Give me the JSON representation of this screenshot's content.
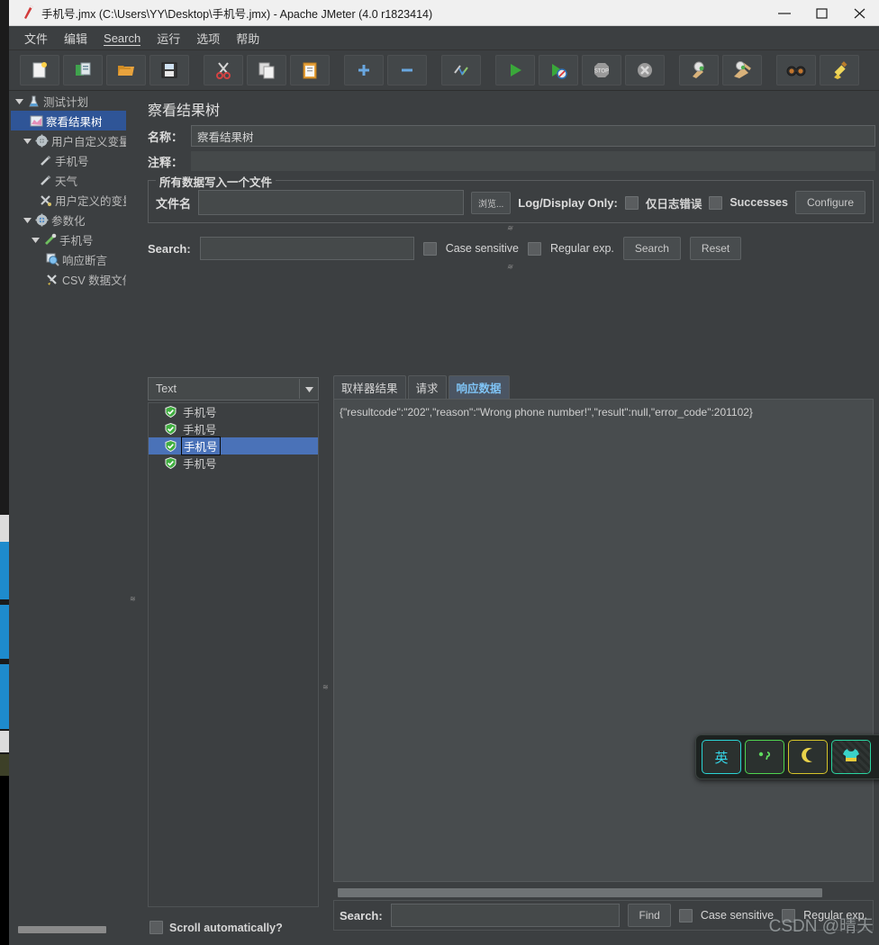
{
  "window": {
    "title": "手机号.jmx (C:\\Users\\YY\\Desktop\\手机号.jmx) - Apache JMeter (4.0 r1823414)",
    "minimize": "minimize-icon",
    "maximize": "maximize-icon",
    "close": "close-icon"
  },
  "menubar": {
    "items": [
      {
        "label": "文件"
      },
      {
        "label": "编辑"
      },
      {
        "label": "Search"
      },
      {
        "label": "运行"
      },
      {
        "label": "选项"
      },
      {
        "label": "帮助"
      }
    ]
  },
  "toolbar": {
    "buttons": [
      {
        "name": "new-icon"
      },
      {
        "name": "templates-icon"
      },
      {
        "name": "open-icon"
      },
      {
        "name": "save-icon"
      },
      {
        "name": "cut-icon"
      },
      {
        "name": "copy-icon"
      },
      {
        "name": "paste-icon"
      },
      {
        "name": "expand-icon"
      },
      {
        "name": "collapse-icon"
      },
      {
        "name": "toggle-icon"
      },
      {
        "name": "start-icon"
      },
      {
        "name": "start-no-pauses-icon"
      },
      {
        "name": "stop-icon"
      },
      {
        "name": "shutdown-icon"
      },
      {
        "name": "clear-icon"
      },
      {
        "name": "clear-all-icon"
      },
      {
        "name": "search-icon"
      },
      {
        "name": "reset-search-icon"
      }
    ]
  },
  "tree": {
    "nodes": [
      {
        "label": "测试计划",
        "indent": 0,
        "toggle": "expanded",
        "icon": "test-plan-icon",
        "selected": false
      },
      {
        "label": "察看结果树",
        "indent": 1,
        "toggle": "none",
        "icon": "view-results-tree-icon",
        "selected": true
      },
      {
        "label": "用户自定义变量",
        "indent": 1,
        "toggle": "expanded",
        "icon": "config-gear-icon",
        "selected": false
      },
      {
        "label": "手机号",
        "indent": 2,
        "toggle": "none",
        "icon": "variable-icon",
        "selected": false
      },
      {
        "label": "天气",
        "indent": 2,
        "toggle": "none",
        "icon": "variable-icon",
        "selected": false
      },
      {
        "label": "用户定义的变量",
        "indent": 2,
        "toggle": "none",
        "icon": "user-variables-icon",
        "selected": false
      },
      {
        "label": "参数化",
        "indent": 1,
        "toggle": "expanded",
        "icon": "thread-group-icon",
        "selected": false
      },
      {
        "label": "手机号",
        "indent": 2,
        "toggle": "expanded",
        "icon": "sampler-icon",
        "selected": false
      },
      {
        "label": "响应断言",
        "indent": 3,
        "toggle": "none",
        "icon": "assertion-icon",
        "selected": false
      },
      {
        "label": "CSV 数据文件",
        "indent": 3,
        "toggle": "none",
        "icon": "csv-dataset-icon",
        "selected": false
      }
    ]
  },
  "panel": {
    "title": "察看结果树",
    "name_label": "名称：",
    "name_value": "察看结果树",
    "comment_label": "注释：",
    "comment_value": "",
    "file_group": {
      "legend": "所有数据写入一个文件",
      "filename_label": "文件名",
      "filename_value": "",
      "browse_button": "浏览...",
      "log_display_label": "Log/Display Only:",
      "errors_only_label": "仅日志错误",
      "successes_label": "Successes",
      "configure_button": "Configure"
    },
    "search": {
      "label": "Search:",
      "value": "",
      "case_sensitive": "Case sensitive",
      "regular_exp": "Regular exp.",
      "search_button": "Search",
      "reset_button": "Reset"
    }
  },
  "results": {
    "renderer_selected": "Text",
    "items": [
      {
        "label": "手机号",
        "status": "success",
        "selected": false
      },
      {
        "label": "手机号",
        "status": "success",
        "selected": false
      },
      {
        "label": "手机号",
        "status": "success",
        "selected": true
      },
      {
        "label": "手机号",
        "status": "success",
        "selected": false
      }
    ],
    "scroll_automatically": "Scroll automatically?"
  },
  "detail": {
    "tabs": [
      {
        "label": "取样器结果",
        "active": false
      },
      {
        "label": "请求",
        "active": false
      },
      {
        "label": "响应数据",
        "active": true
      }
    ],
    "response_text": "{\"resultcode\":\"202\",\"reason\":\"Wrong phone number!\",\"result\":null,\"error_code\":201102}",
    "find": {
      "label": "Search:",
      "value": "",
      "find_button": "Find",
      "case_sensitive": "Case sensitive",
      "regular_exp": "Regular exp."
    }
  },
  "ime": {
    "keys": [
      {
        "name": "language-mode-key",
        "label": "英"
      },
      {
        "name": "punctuation-mode-key",
        "label": ""
      },
      {
        "name": "moon-mode-key",
        "label": ""
      },
      {
        "name": "skin-key",
        "label": ""
      }
    ]
  },
  "watermark": "CSDN @晴天",
  "colors": {
    "accent": "#2f5597",
    "selection": "#4a72b8",
    "tab_active_text": "#7fc3f5",
    "panel_bg": "#3c3f41"
  }
}
